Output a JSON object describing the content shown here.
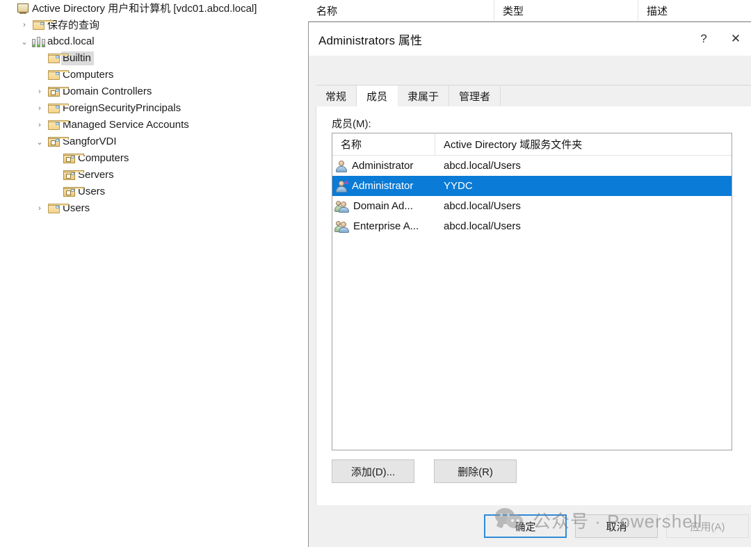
{
  "mmc": {
    "columns": [
      "名称",
      "类型",
      "描述"
    ],
    "tree": [
      {
        "label": "Active Directory 用户和计算机 [vdc01.abcd.local]",
        "indent": 0,
        "twisty": "",
        "icon": "console-icon",
        "selected": false
      },
      {
        "label": "保存的查询",
        "indent": 1,
        "twisty": "›",
        "icon": "folder-icon",
        "selected": false
      },
      {
        "label": "abcd.local",
        "indent": 1,
        "twisty": "⌄",
        "icon": "domain-icon",
        "selected": false
      },
      {
        "label": "Builtin",
        "indent": 2,
        "twisty": "",
        "icon": "folder-icon",
        "selected": true
      },
      {
        "label": "Computers",
        "indent": 2,
        "twisty": "",
        "icon": "folder-icon",
        "selected": false
      },
      {
        "label": "Domain Controllers",
        "indent": 2,
        "twisty": "›",
        "icon": "ou-icon",
        "selected": false
      },
      {
        "label": "ForeignSecurityPrincipals",
        "indent": 2,
        "twisty": "›",
        "icon": "folder-icon",
        "selected": false
      },
      {
        "label": "Managed Service Accounts",
        "indent": 2,
        "twisty": "›",
        "icon": "folder-icon",
        "selected": false
      },
      {
        "label": "SangforVDI",
        "indent": 2,
        "twisty": "⌄",
        "icon": "ou-icon",
        "selected": false
      },
      {
        "label": "Computers",
        "indent": 3,
        "twisty": "",
        "icon": "ou-icon",
        "selected": false
      },
      {
        "label": "Servers",
        "indent": 3,
        "twisty": "",
        "icon": "ou-icon",
        "selected": false
      },
      {
        "label": "Users",
        "indent": 3,
        "twisty": "",
        "icon": "ou-icon",
        "selected": false
      },
      {
        "label": "Users",
        "indent": 2,
        "twisty": "›",
        "icon": "folder-icon",
        "selected": false
      }
    ]
  },
  "dialog": {
    "title": "Administrators 属性",
    "help_label": "?",
    "close_label": "✕",
    "tabs": [
      {
        "label": "常规",
        "active": false
      },
      {
        "label": "成员",
        "active": true
      },
      {
        "label": "隶属于",
        "active": false
      },
      {
        "label": "管理者",
        "active": false
      }
    ],
    "members_label": "成员(M):",
    "list": {
      "headers": [
        "名称",
        "Active Directory 域服务文件夹"
      ],
      "rows": [
        {
          "name": "Administrator",
          "folder": "abcd.local/Users",
          "icon": "user-icon",
          "selected": false
        },
        {
          "name": "Administrator",
          "folder": "YYDC",
          "icon": "user-arrow-icon",
          "selected": true
        },
        {
          "name": "Domain Ad...",
          "folder": "abcd.local/Users",
          "icon": "group-icon",
          "selected": false
        },
        {
          "name": "Enterprise A...",
          "folder": "abcd.local/Users",
          "icon": "group-icon",
          "selected": false
        }
      ]
    },
    "list_buttons": [
      {
        "label": "添加(D)..."
      },
      {
        "label": "删除(R)"
      }
    ],
    "footer_buttons": [
      {
        "label": "确定",
        "style": "default"
      },
      {
        "label": "取消",
        "style": "normal"
      },
      {
        "label": "应用(A)",
        "style": "disabled"
      }
    ]
  },
  "watermark": {
    "text": "公众号 · Powershell",
    "logo": "wechat-icon"
  },
  "colors": {
    "selection_blue": "#0a7bd6",
    "default_button_border": "#2f8ad6",
    "dialog_bg": "#f0f0f0"
  }
}
